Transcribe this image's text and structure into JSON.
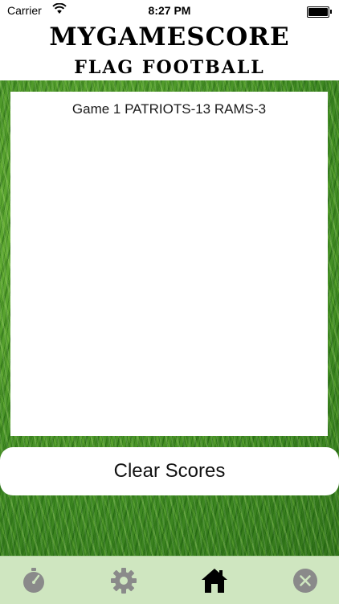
{
  "status_bar": {
    "carrier": "Carrier",
    "time": "8:27 PM"
  },
  "header": {
    "title": "MYGAMESCORE",
    "subtitle": "FLAG FOOTBALL"
  },
  "scores": [
    "Game 1 PATRIOTS-13 RAMS-3"
  ],
  "clear_button_label": "Clear Scores",
  "tab_bar": {
    "tabs": [
      {
        "icon": "stopwatch-icon",
        "active": false
      },
      {
        "icon": "gear-icon",
        "active": false
      },
      {
        "icon": "home-icon",
        "active": true
      },
      {
        "icon": "close-circle-icon",
        "active": false
      }
    ]
  },
  "colors": {
    "grass": "#4f9a2a",
    "tab_bar": "#cfe6c0",
    "icon_inactive": "#8a8a8a",
    "icon_active": "#000000"
  }
}
